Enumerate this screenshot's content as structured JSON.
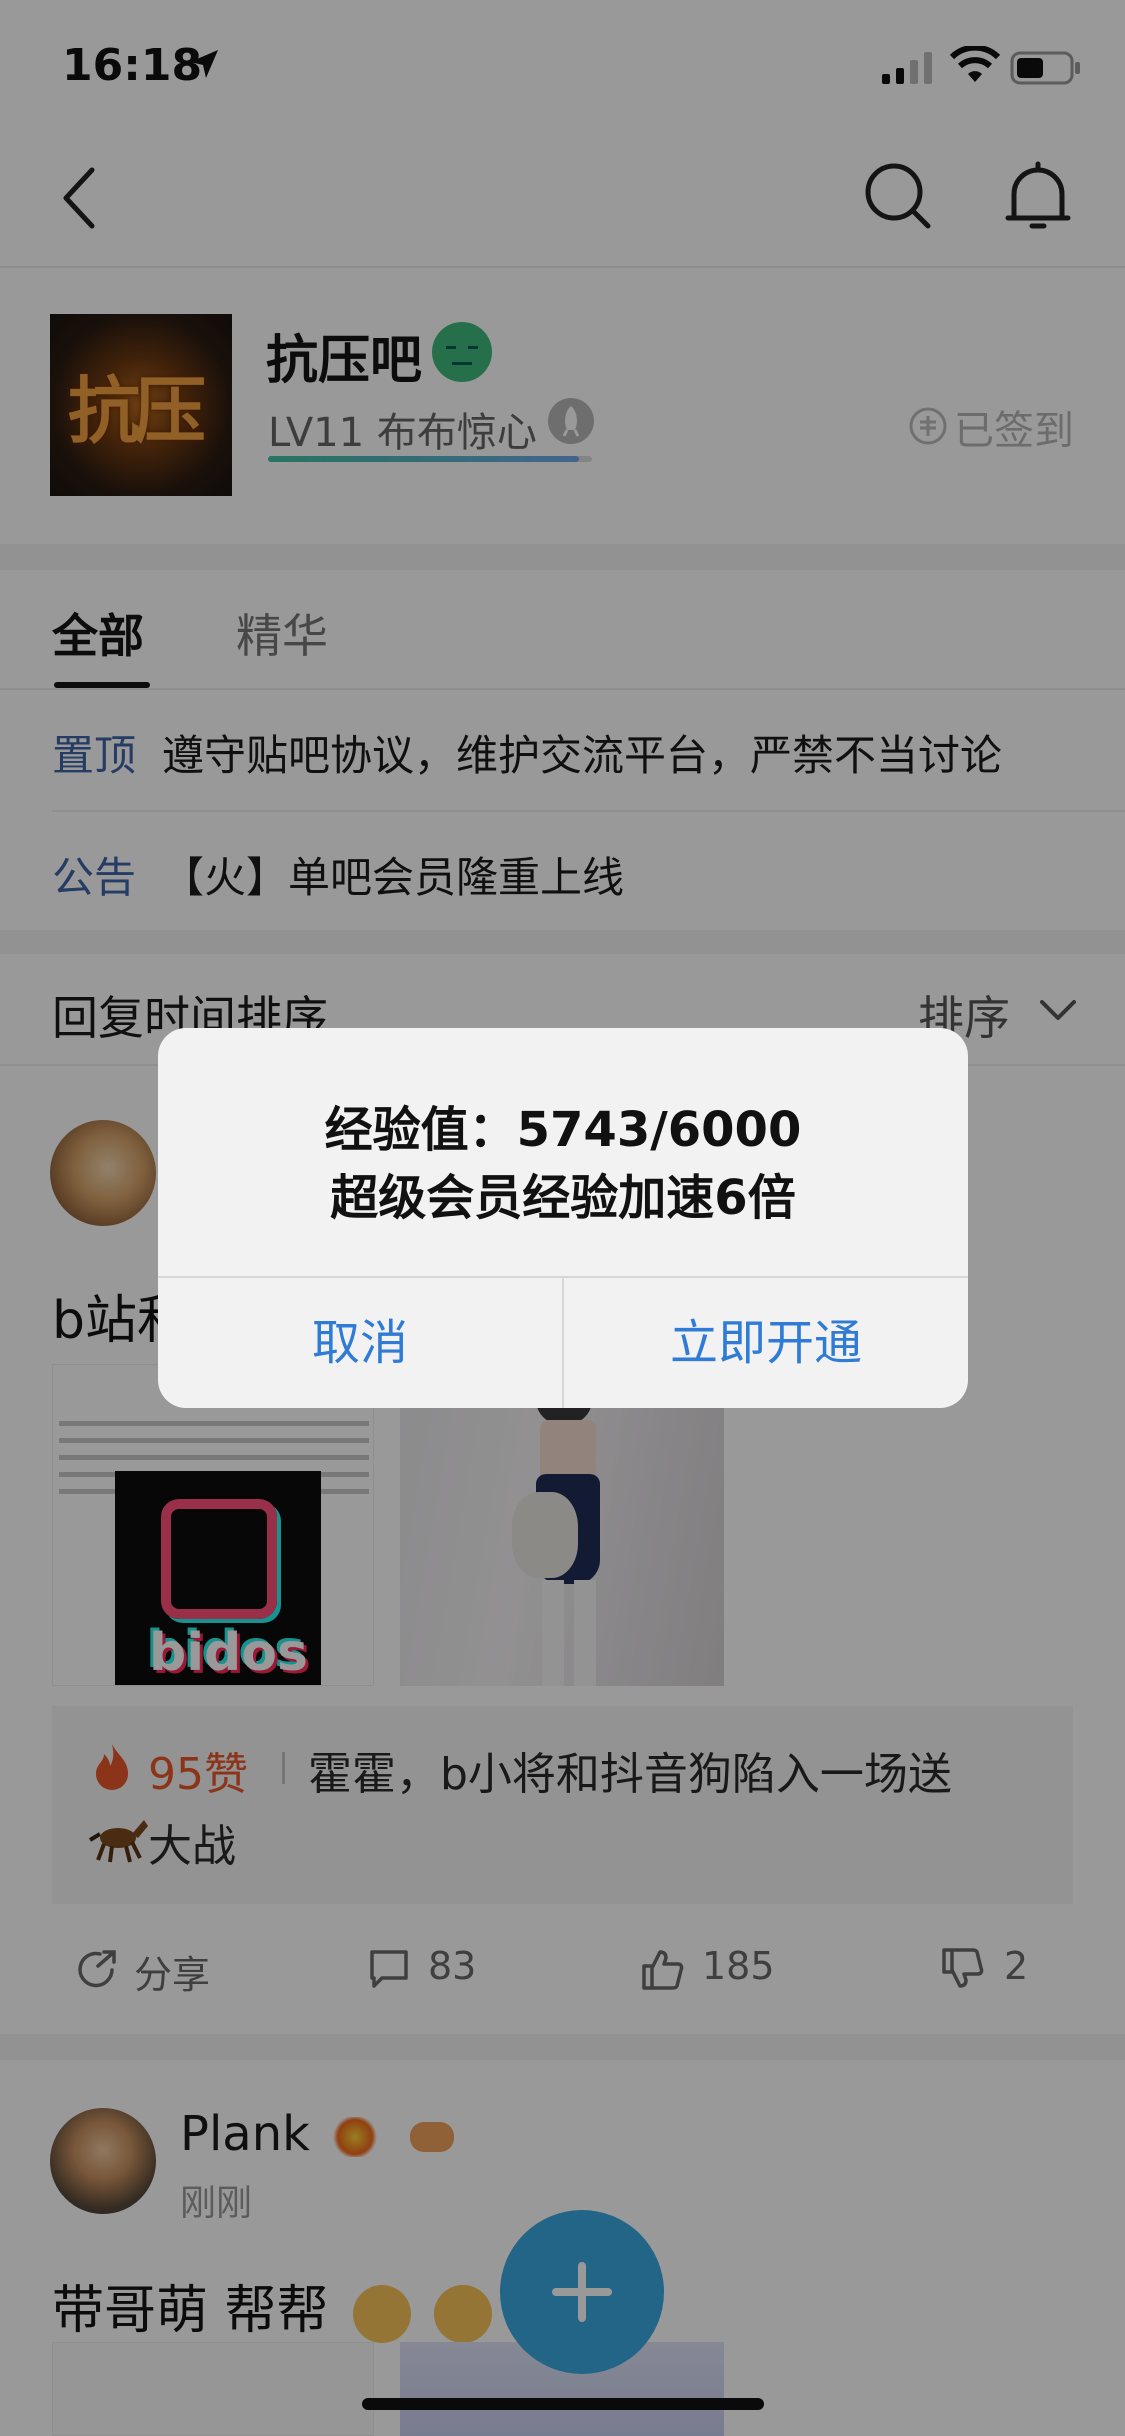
{
  "status_bar": {
    "time": "16:18"
  },
  "forum": {
    "name": "抗压吧",
    "avatar_text": "抗压",
    "level": "LV11 布布惊心",
    "level_progress": 0.96,
    "signed_label": "已签到"
  },
  "tabs": [
    {
      "label": "全部",
      "active": true
    },
    {
      "label": "精华",
      "active": false
    }
  ],
  "pinned": [
    {
      "tag": "置顶",
      "text": "遵守贴吧协议，维护交流平台，严禁不当讨论"
    },
    {
      "tag": "公告",
      "text": "【火】单吧会员隆重上线"
    }
  ],
  "sort": {
    "title": "回复时间排序",
    "button": "排序"
  },
  "post1": {
    "title": "b站和",
    "image1_word": "bidos",
    "quote_likes": "95赞",
    "quote_text_line1": "霍霍，b小将和抖音狗陷入一场送",
    "quote_text_line2": "大战",
    "actions": {
      "share": "分享",
      "comments": "83",
      "likes": "185",
      "dislikes": "2"
    }
  },
  "post2": {
    "author": "Plank",
    "time": "刚刚",
    "title": "带哥萌 帮帮"
  },
  "alert": {
    "line1": "经验值：5743/6000",
    "line2": "超级会员经验加速6倍",
    "cancel": "取消",
    "confirm": "立即开通"
  },
  "colors": {
    "accent": "#2f7bd6",
    "tag_blue": "#3f64a8",
    "likes_orange": "#e8582a",
    "fab": "#3aa9e0"
  }
}
